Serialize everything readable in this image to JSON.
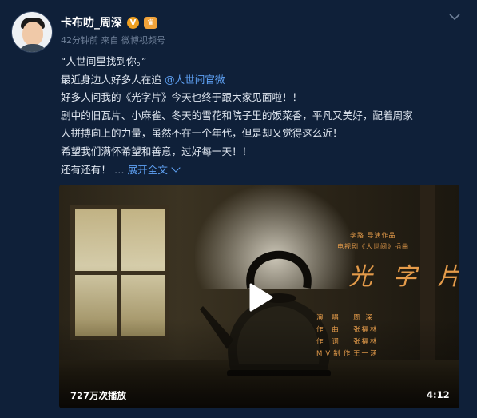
{
  "post": {
    "author": "卡布叻_周深",
    "time_source": "42分钟前 来自 微博视频号",
    "lines": {
      "l1": "“人世间里找到你。”",
      "l2_prefix": "最近身边人好多人在追 ",
      "l2_mention": "@人世间官微",
      "l3": "好多人问我的《光字片》今天也终于跟大家见面啦！！",
      "l4": "剧中的旧瓦片、小麻雀、冬天的雪花和院子里的饭菜香，平凡又美好，配着周家",
      "l5": "人拼搏向上的力量，虽然不在一个年代，但是却又觉得这么近！",
      "l6": "希望我们满怀希望和善意，过好每一天！！",
      "l7_prefix": "还有还有！",
      "ellipsis": " … ",
      "expand": "展开全文"
    },
    "badges": {
      "verified": "V",
      "crown": "♛"
    }
  },
  "video": {
    "title": "光 字 片",
    "top_credit_1": "李路  导演作品",
    "top_credit_2": "电视剧《人世间》插曲",
    "credits": [
      {
        "role": "演 唱",
        "who": "周 深"
      },
      {
        "role": "作 曲",
        "who": "张福林"
      },
      {
        "role": "作 词",
        "who": "张福林"
      },
      {
        "role": "MV制作",
        "who": "王一涵"
      }
    ],
    "views": "727万次播放",
    "duration": "4:12"
  },
  "colors": {
    "background": "#0f2039",
    "link": "#5fa2f5",
    "title_orange": "#e49b4a"
  },
  "icons": {
    "more": "chevron-down-icon",
    "play": "play-icon",
    "expand": "chevron-down-icon"
  }
}
